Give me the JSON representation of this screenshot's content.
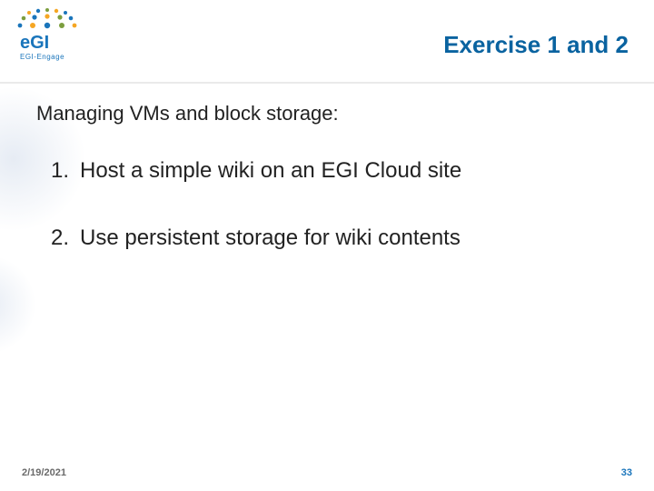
{
  "logo": {
    "brand": "egi",
    "subbrand": "EGI-Engage"
  },
  "title": "Exercise 1 and 2",
  "lead": "Managing VMs and block storage:",
  "items": [
    "Host a simple wiki on an EGI Cloud site",
    "Use persistent storage for wiki contents"
  ],
  "footer": {
    "date": "2/19/2021",
    "page": "33"
  },
  "colors": {
    "accent": "#1a75bb"
  }
}
